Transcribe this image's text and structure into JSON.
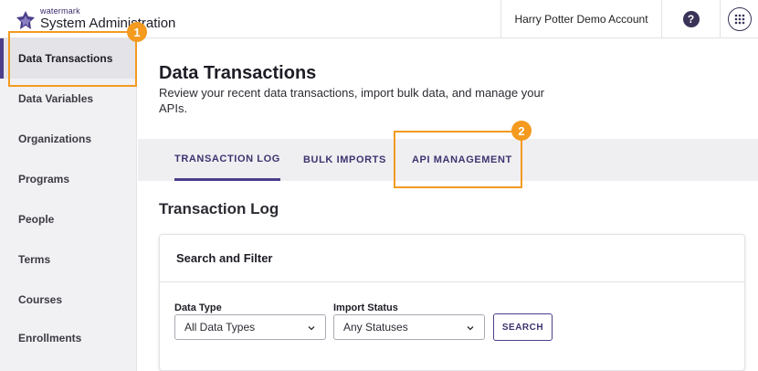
{
  "header": {
    "logo_small": "watermark",
    "logo_title": "System Administration",
    "account_name": "Harry Potter Demo Account",
    "help_icon_glyph": "?",
    "help_icon": "help-icon",
    "apps_icon": "apps-grid-icon"
  },
  "sidebar": {
    "items": [
      {
        "label": "Data Transactions",
        "active": true
      },
      {
        "label": "Data Variables"
      },
      {
        "label": "Organizations"
      },
      {
        "label": "Programs"
      },
      {
        "label": "People"
      },
      {
        "label": "Terms"
      },
      {
        "label": "Courses"
      },
      {
        "label": "Enrollments"
      }
    ]
  },
  "main": {
    "title": "Data Transactions",
    "description": "Review your recent data transactions, import bulk data, and manage your APIs.",
    "tabs": [
      {
        "label": "TRANSACTION LOG",
        "active": true
      },
      {
        "label": "BULK IMPORTS"
      },
      {
        "label": "API MANAGEMENT"
      }
    ],
    "section_title": "Transaction Log",
    "filter_card": {
      "title": "Search and Filter",
      "data_type_label": "Data Type",
      "data_type_value": "All Data Types",
      "import_status_label": "Import Status",
      "import_status_value": "Any Statuses",
      "search_label": "SEARCH"
    }
  },
  "callouts": [
    {
      "number": "1"
    },
    {
      "number": "2"
    }
  ],
  "colors": {
    "accent": "#4b3f8a",
    "callout": "#f39a1f",
    "sidebar_bg": "#f1f1f3"
  }
}
